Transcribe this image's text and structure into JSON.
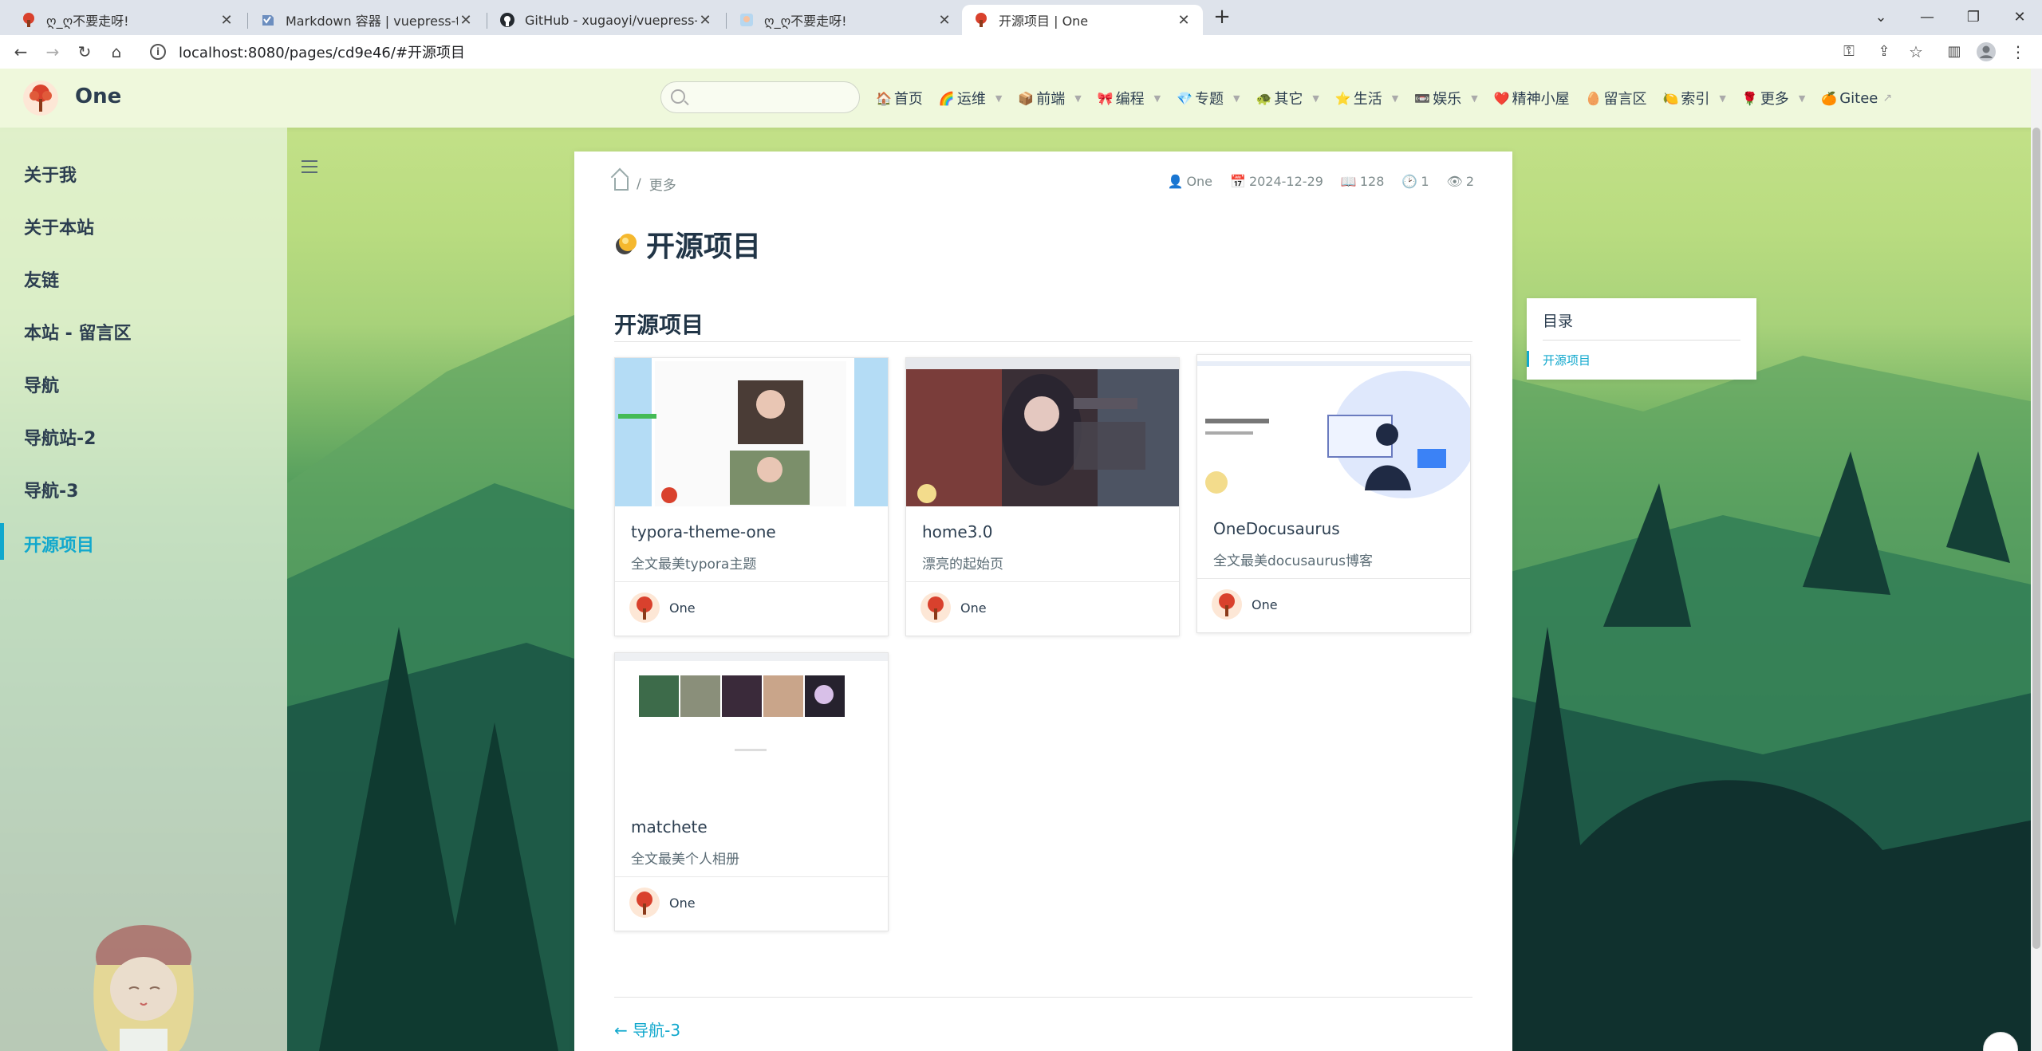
{
  "browser": {
    "tabs": [
      {
        "title": "ღ_ღ不要走呀!",
        "active": false
      },
      {
        "title": "Markdown 容器 | vuepress-the",
        "active": false
      },
      {
        "title": "GitHub - xugaoyi/vuepress-th",
        "active": false
      },
      {
        "title": "ღ_ღ不要走呀!",
        "active": false
      },
      {
        "title": "开源项目 | One",
        "active": true
      }
    ],
    "new_tab": "+",
    "url": "localhost:8080/pages/cd9e46/#开源项目",
    "window_controls": [
      "chevron-down-icon",
      "minimize-icon",
      "restore-icon",
      "close-icon"
    ]
  },
  "navbar": {
    "site_name": "One",
    "search_placeholder": "",
    "items": [
      {
        "icon": "🏠",
        "label": "首页",
        "dropdown": false
      },
      {
        "icon": "🌈",
        "label": "运维",
        "dropdown": true
      },
      {
        "icon": "📦",
        "label": "前端",
        "dropdown": true
      },
      {
        "icon": "🎀",
        "label": "编程",
        "dropdown": true
      },
      {
        "icon": "💎",
        "label": "专题",
        "dropdown": true
      },
      {
        "icon": "🐢",
        "label": "其它",
        "dropdown": true
      },
      {
        "icon": "⭐",
        "label": "生活",
        "dropdown": true
      },
      {
        "icon": "📼",
        "label": "娱乐",
        "dropdown": true
      },
      {
        "icon": "❤️",
        "label": "精神小屋",
        "dropdown": false
      },
      {
        "icon": "🥚",
        "label": "留言区",
        "dropdown": false
      },
      {
        "icon": "🍋",
        "label": "索引",
        "dropdown": true
      },
      {
        "icon": "🌹",
        "label": "更多",
        "dropdown": true
      },
      {
        "icon": "🍊",
        "label": "Gitee",
        "dropdown": false,
        "external": true
      }
    ]
  },
  "sidebar": {
    "items": [
      {
        "label": "关于我",
        "active": false
      },
      {
        "label": "关于本站",
        "active": false
      },
      {
        "label": "友链",
        "active": false
      },
      {
        "label": "本站 - 留言区",
        "active": false
      },
      {
        "label": "导航",
        "active": false
      },
      {
        "label": "导航站-2",
        "active": false
      },
      {
        "label": "导航-3",
        "active": false
      },
      {
        "label": "开源项目",
        "active": true
      }
    ]
  },
  "breadcrumb": {
    "separator": "/",
    "current": "更多"
  },
  "meta": {
    "author": "One",
    "date": "2024-12-29",
    "words": "128",
    "read_time": "1",
    "views": "2"
  },
  "page": {
    "title": "开源项目",
    "heading": "开源项目",
    "cards": [
      {
        "name": "typora-theme-one",
        "desc": "全文最美typora主题",
        "author": "One"
      },
      {
        "name": "home3.0",
        "desc": "漂亮的起始页",
        "author": "One"
      },
      {
        "name": "OneDocusaurus",
        "desc": "全文最美docusaurus博客",
        "author": "One"
      },
      {
        "name": "matchete",
        "desc": "全文最美个人相册",
        "author": "One"
      }
    ],
    "prev_link": "← 导航-3"
  },
  "toc": {
    "title": "目录",
    "items": [
      "开源项目"
    ]
  },
  "colors": {
    "accent": "#11a8cd",
    "navbar_bg": "#f2fae2",
    "text": "#2c3e50"
  }
}
